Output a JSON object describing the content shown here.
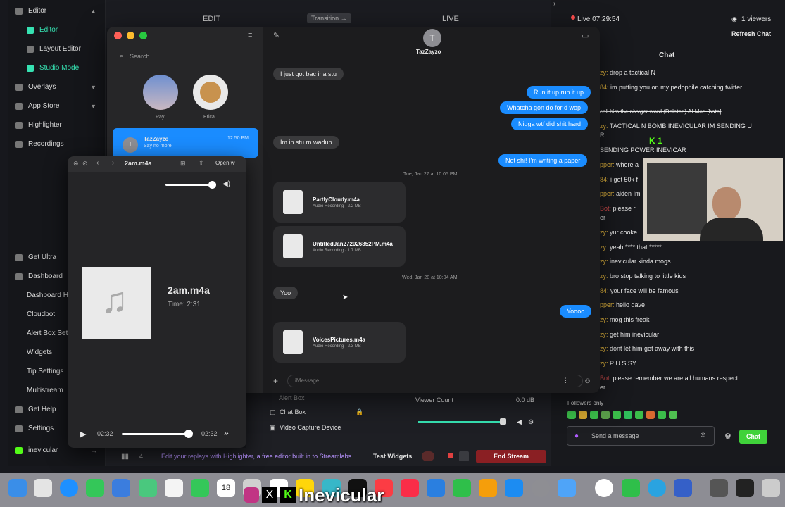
{
  "sidebar": {
    "items": [
      {
        "label": "Editor",
        "icon": "editor-icon"
      },
      {
        "label": "Editor",
        "icon": "editor-icon"
      },
      {
        "label": "Layout Editor",
        "icon": "layout-icon"
      },
      {
        "label": "Studio Mode",
        "icon": "studio-icon"
      },
      {
        "label": "Overlays",
        "icon": "overlays-icon"
      },
      {
        "label": "App Store",
        "icon": "store-icon"
      },
      {
        "label": "Highlighter",
        "icon": "highlighter-icon"
      },
      {
        "label": "Recordings",
        "icon": "recordings-icon"
      }
    ],
    "lower": [
      {
        "label": "Get Ultra"
      },
      {
        "label": "Dashboard"
      },
      {
        "label": "Dashboard H"
      },
      {
        "label": "Cloudbot"
      },
      {
        "label": "Alert Box Set"
      },
      {
        "label": "Widgets"
      },
      {
        "label": "Tip Settings"
      },
      {
        "label": "Multistream"
      },
      {
        "label": "Get Help"
      },
      {
        "label": "Settings"
      }
    ],
    "user": "inevicular"
  },
  "topbar": {
    "edit": "EDIT",
    "transition": "Transition →",
    "live": "LIVE"
  },
  "live": {
    "status": "Live 07:29:54",
    "viewers": "1 viewers",
    "refresh": "Refresh Chat",
    "chat_title": "Chat"
  },
  "messages": {
    "search_placeholder": "Search",
    "pinned": [
      {
        "name": "Ray"
      },
      {
        "name": "Erica"
      }
    ],
    "convo": {
      "name": "TazZayzo",
      "preview": "Say no more",
      "time": "12:50 PM",
      "avatar": "T"
    },
    "header_name": "TazZayzo",
    "bubbles": [
      {
        "text": "I just got bac ina stu",
        "dir": "in"
      },
      {
        "text": "Run it up run it up",
        "dir": "out"
      },
      {
        "text": "Whatcha gon do for d wop",
        "dir": "out"
      },
      {
        "text": "Nigga wtf did shit hard",
        "dir": "out"
      },
      {
        "text": "Im in stu rn wadup",
        "dir": "in"
      },
      {
        "text": "Not shi! I'm writing a paper",
        "dir": "out"
      },
      {
        "text": "Yoo",
        "dir": "in"
      },
      {
        "text": "Yoooo",
        "dir": "out"
      }
    ],
    "stamps": [
      "Tue, Jan 27 at 10:05 PM",
      "Wed, Jan 28 at 10:04 AM"
    ],
    "files": [
      {
        "name": "PartlyCloudy.m4a",
        "size": "Audio Recording · 2.2 MB"
      },
      {
        "name": "UntitledJan272026852PM.m4a",
        "size": "Audio Recording · 1.7 MB"
      },
      {
        "name": "VoicesPictures.m4a",
        "size": "Audio Recording · 2.3 MB"
      }
    ],
    "input_placeholder": "iMessage"
  },
  "player": {
    "title": "2am.m4a",
    "open": "Open w",
    "file": "2am.m4a",
    "time": "Time: 2:31",
    "elapsed": "02:32",
    "remaining": "02:32",
    "volume": 0.9,
    "progress": 0.98
  },
  "chat": [
    {
      "user": "zy:",
      "text": "drop a tactical N"
    },
    {
      "user": "84:",
      "text": "im putting you on my pedophile catching twitter"
    },
    {
      "user": "",
      "text": "call him the nixxger word (Deleted) AI Mod [hate]"
    },
    {
      "user": "zy:",
      "text": "TACTICAL N BOMB INEVICULAR IM SENDING U"
    },
    {
      "user": "",
      "text": "R"
    },
    {
      "user": "",
      "text": "K 1"
    },
    {
      "user": "",
      "text": "SENDING POWER INEVICAR"
    },
    {
      "user": "pper:",
      "text": "where a"
    },
    {
      "user": "84:",
      "text": "i got 50k f"
    },
    {
      "user": "pper:",
      "text": "aiden Im"
    },
    {
      "user": "Bot:",
      "text": "please r"
    },
    {
      "user": "",
      "text": "er"
    },
    {
      "user": "zy:",
      "text": "yur cooke"
    },
    {
      "user": "zy:",
      "text": "yeah **** that *****"
    },
    {
      "user": "zy:",
      "text": "inevicular kinda mogs"
    },
    {
      "user": "zy:",
      "text": "bro stop talking to little kids"
    },
    {
      "user": "84:",
      "text": "your face will be famous"
    },
    {
      "user": "pper:",
      "text": "hello dave"
    },
    {
      "user": "zy:",
      "text": "mog this freak"
    },
    {
      "user": "zy:",
      "text": "get him inevicular"
    },
    {
      "user": "zy:",
      "text": "dont let him get away with this"
    },
    {
      "user": "zy:",
      "text": "P U S SY"
    },
    {
      "user": "Bot:",
      "text": "please remember we are all humans respect"
    },
    {
      "user": "",
      "text": "er"
    }
  ],
  "chat_footer": {
    "followers": "Followers only",
    "placeholder": "Send a message",
    "button": "Chat"
  },
  "sources": [
    "Alert Box",
    "Chat Box",
    "Video Capture Device"
  ],
  "mixer": {
    "label": "Viewer Count",
    "db": "0.0 dB"
  },
  "bottom": {
    "notice": "Edit your replays with Highlighter, a free editor built in to Streamlabs.",
    "test": "Test Widgets",
    "end": "End Stream",
    "count": "4"
  },
  "dock": {
    "date": "18",
    "watermark": "Inevicular"
  }
}
